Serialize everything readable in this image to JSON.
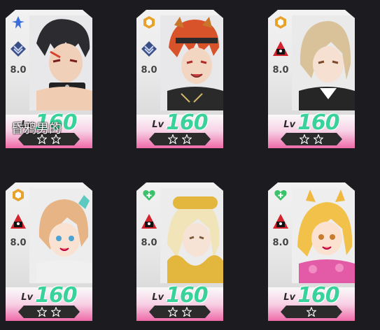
{
  "cards": [
    {
      "score": "8.0",
      "level_label": "Lv",
      "level": "160",
      "stars": 2,
      "rank_icon": "blue-plane-icon",
      "role_icon": "blue-chevron-icon",
      "hair": "#2b2b30",
      "skin": "#f0d0b8",
      "accent": "#d8412e"
    },
    {
      "score": "8.0",
      "level_label": "Lv",
      "level": "160",
      "stars": 2,
      "rank_icon": "gold-hexagon-icon",
      "role_icon": "blue-chevron-icon",
      "hair": "#d8532a",
      "skin": "#f2d6c2",
      "accent": "#2a2a2a"
    },
    {
      "score": "8.0",
      "level_label": "Lv",
      "level": "160",
      "stars": 2,
      "rank_icon": "gold-hexagon-icon",
      "role_icon": "red-triangle-icon",
      "hair": "#d9c29a",
      "skin": "#f6e0d2",
      "accent": "#2a2a2a"
    },
    {
      "score": "8.0",
      "level_label": "Lv",
      "level": "160",
      "stars": 2,
      "rank_icon": "gold-hexagon-icon",
      "role_icon": "red-triangle-icon",
      "hair": "#e6b485",
      "skin": "#f9e2d2",
      "accent": "#5ec9c0"
    },
    {
      "score": "8.0",
      "level_label": "Lv",
      "level": "160",
      "stars": 2,
      "rank_icon": "green-heart-icon",
      "role_icon": "red-triangle-icon",
      "hair": "#f1e4b8",
      "skin": "#f6e3d6",
      "accent": "#e3b63e"
    },
    {
      "score": "8.0",
      "level_label": "Lv",
      "level": "160",
      "stars": 1,
      "rank_icon": "green-heart-icon",
      "role_icon": "red-triangle-icon",
      "hair": "#f2c14a",
      "skin": "#fbe1cf",
      "accent": "#e35aa6"
    }
  ],
  "overlay_text": "昏鸦男的"
}
